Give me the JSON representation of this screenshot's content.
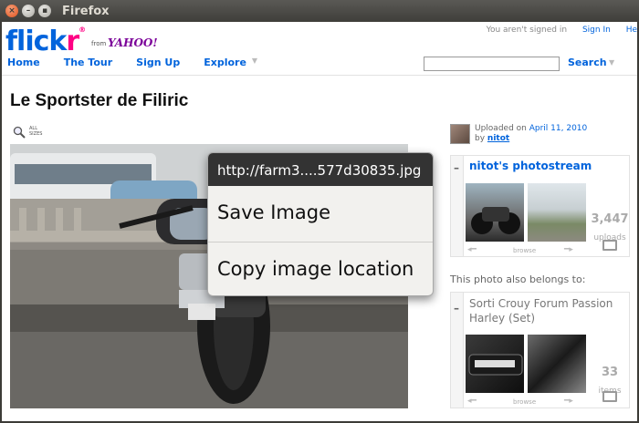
{
  "window": {
    "title": "Firefox"
  },
  "header": {
    "logo_blue": "flick",
    "logo_pink": "r",
    "from": "from",
    "yahoo": "YAHOO!",
    "signed_in_text": "You aren't signed in",
    "sign_in": "Sign In",
    "help": "He",
    "nav": [
      "Home",
      "The Tour",
      "Sign Up",
      "Explore"
    ],
    "search_label": "Search"
  },
  "photo_title": "Le Sportster de Filiric",
  "all_sizes": [
    "ALL",
    "SIZES"
  ],
  "context_menu": {
    "url": "http://farm3....577d30835.jpg",
    "items": [
      "Save Image",
      "Copy image location"
    ]
  },
  "sidebar": {
    "uploaded_prefix": "Uploaded on",
    "uploaded_date": "April 11, 2010",
    "by": "by",
    "owner": "nitot",
    "stream_title": "nitot's photostream",
    "stream_count": "3,447",
    "stream_count_label": "uploads",
    "browse": "browse",
    "belongs_text": "This photo also belongs to:",
    "set_name_line1": "Sorti Crouy Forum Passion",
    "set_name_line2": "Harley (Set)",
    "set_count": "33",
    "set_count_label": "items"
  }
}
